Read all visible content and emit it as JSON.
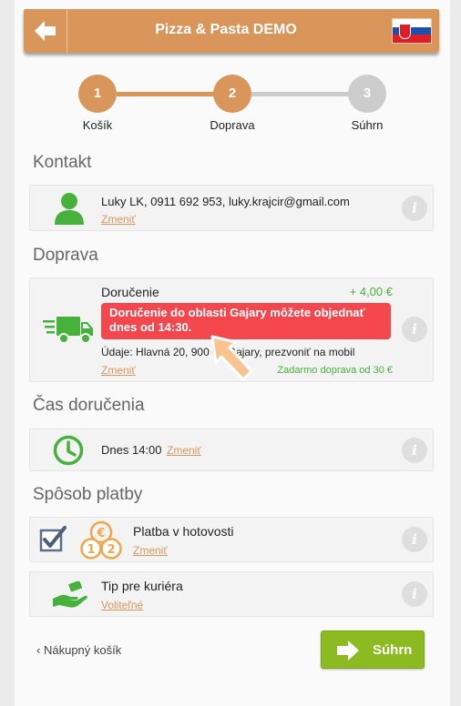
{
  "header": {
    "title": "Pizza & Pasta DEMO",
    "flag": "slovakia-flag"
  },
  "steps": [
    {
      "number": "1",
      "label": "Košík"
    },
    {
      "number": "2",
      "label": "Doprava"
    },
    {
      "number": "3",
      "label": "Súhrn"
    }
  ],
  "contact": {
    "section_title": "Kontakt",
    "info_text": "Luky LK, 0911 692 953, luky.krajcir@gmail.com",
    "change_link": "Zmeniť"
  },
  "delivery": {
    "section_title": "Doprava",
    "method": "Doručenie",
    "price": "+ 4,00 €",
    "alert": "Doručenie do oblasti Gajary môžete objednať dnes od 14:30.",
    "details": "Údaje: Hlavná 20, 900 62 Gajary, prezvoniť na mobil",
    "change_link": "Zmeniť",
    "free_delivery": "Zadarmo doprava od 30 €"
  },
  "delivery_time": {
    "section_title": "Čas doručenia",
    "value": "Dnes 14:00",
    "change_link": "Zmeniť"
  },
  "payment": {
    "section_title": "Spôsob platby",
    "method": "Platba v hotovosti",
    "change_link": "Zmeniť",
    "checked": true
  },
  "tip": {
    "label": "Tip pre kuriéra",
    "link": "Voliteľné"
  },
  "footer": {
    "back_label": "Nákupný košík",
    "summary_button": "Súhrn"
  },
  "colors": {
    "accent": "#d9955a",
    "green": "#46b13b",
    "alert": "#f3474d",
    "button": "#8bbb21",
    "step_inactive": "#cccccc"
  }
}
